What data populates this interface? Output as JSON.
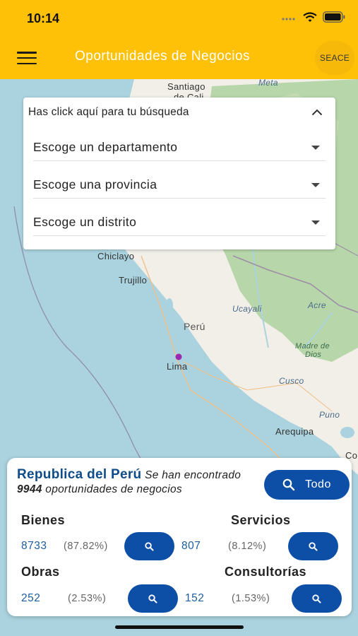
{
  "status_bar": {
    "time": "10:14"
  },
  "app_bar": {
    "title": "Oportunidades de Negocios",
    "seace_label": "SEACE"
  },
  "search": {
    "header": "Has click aquí para tu búsqueda",
    "department_placeholder": "Escoge un departamento",
    "province_placeholder": "Escoge una provincia",
    "district_placeholder": "Escoge un distrito"
  },
  "map": {
    "labels": {
      "santiago": "Santiago",
      "de_cali": "de Cali",
      "meta": "Meta",
      "chiclayo": "Chiclayo",
      "trujillo": "Trujillo",
      "ucayali": "Ucayali",
      "acre": "Acre",
      "peru": "Perú",
      "madre_de": "Madre de",
      "dios": "Dios",
      "lima": "Lima",
      "cusco": "Cusco",
      "puno": "Puno",
      "arequipa": "Arequipa",
      "co": "Co"
    },
    "colors": {
      "ocean": "#aad3df",
      "land": "#f2efe9",
      "forest": "#add19e",
      "marker": "#9c27b0"
    }
  },
  "summary": {
    "country": "Republica del Perú",
    "text_before": "Se han encontrado",
    "total": "9944",
    "text_after": "oportunidades de negocios",
    "todo_label": "Todo",
    "categories": {
      "bienes": {
        "title": "Bienes",
        "count": "8733",
        "percent": "(87.82%)"
      },
      "servicios": {
        "title": "Servicios",
        "count": "807",
        "percent": "(8.12%)"
      },
      "obras": {
        "title": "Obras",
        "count": "252",
        "percent": "(2.53%)"
      },
      "consultorias": {
        "title": "Consultorías",
        "count": "152",
        "percent": "(1.53%)"
      }
    }
  },
  "colors": {
    "accent": "#ffc107",
    "primary": "#0d4ea6",
    "country_text": "#0f4c8a"
  }
}
